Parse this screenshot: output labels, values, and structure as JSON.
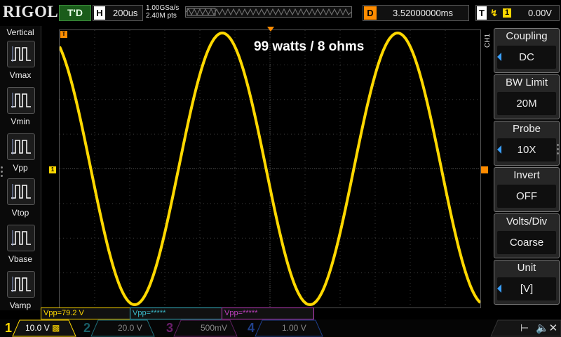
{
  "header": {
    "brand": "RIGOL",
    "run_status": "T'D",
    "timebase_key": "H",
    "timebase_value": "200us",
    "sample_rate": "1.00GSa/s",
    "memory_depth": "2.40M pts",
    "delay_key": "D",
    "delay_value": "3.52000000ms",
    "trigger_key": "T",
    "trigger_edge": "↯",
    "trigger_source": "1",
    "trigger_level": "0.00V"
  },
  "left_panel": {
    "title": "Vertical",
    "items": [
      {
        "label": "Vmax",
        "icon": "vmax-icon"
      },
      {
        "label": "Vmin",
        "icon": "vmin-icon"
      },
      {
        "label": "Vpp",
        "icon": "vpp-icon"
      },
      {
        "label": "Vtop",
        "icon": "vtop-icon"
      },
      {
        "label": "Vbase",
        "icon": "vbase-icon"
      },
      {
        "label": "Vamp",
        "icon": "vamp-icon"
      }
    ]
  },
  "display": {
    "annotation": "99 watts / 8 ohms",
    "waveform_color": "#ffd800",
    "trigger_marker": "T",
    "channel_marker": "1"
  },
  "right_panel": {
    "channel_tag": "CH1",
    "items": [
      {
        "title": "Coupling",
        "value": "DC"
      },
      {
        "title": "BW Limit",
        "value": "20M"
      },
      {
        "title": "Probe",
        "value": "10X"
      },
      {
        "title": "Invert",
        "value": "OFF"
      },
      {
        "title": "Volts/Div",
        "value": "Coarse"
      },
      {
        "title": "Unit",
        "value": "[V]"
      }
    ]
  },
  "measurements": [
    {
      "text": "Vpp=79.2 V",
      "color": "#ffd800"
    },
    {
      "text": "Vpp=*****",
      "color": "#3ab8c8"
    },
    {
      "text": "Vpp=*****",
      "color": "#c040c0"
    }
  ],
  "channels": [
    {
      "num": "1",
      "scale": "10.0 V",
      "color": "#ffd800"
    },
    {
      "num": "2",
      "scale": "20.0 V",
      "color": "#2aa8b8"
    },
    {
      "num": "3",
      "scale": "500mV",
      "color": "#b030b0"
    },
    {
      "num": "4",
      "scale": "1.00 V",
      "color": "#3060d0"
    }
  ]
}
